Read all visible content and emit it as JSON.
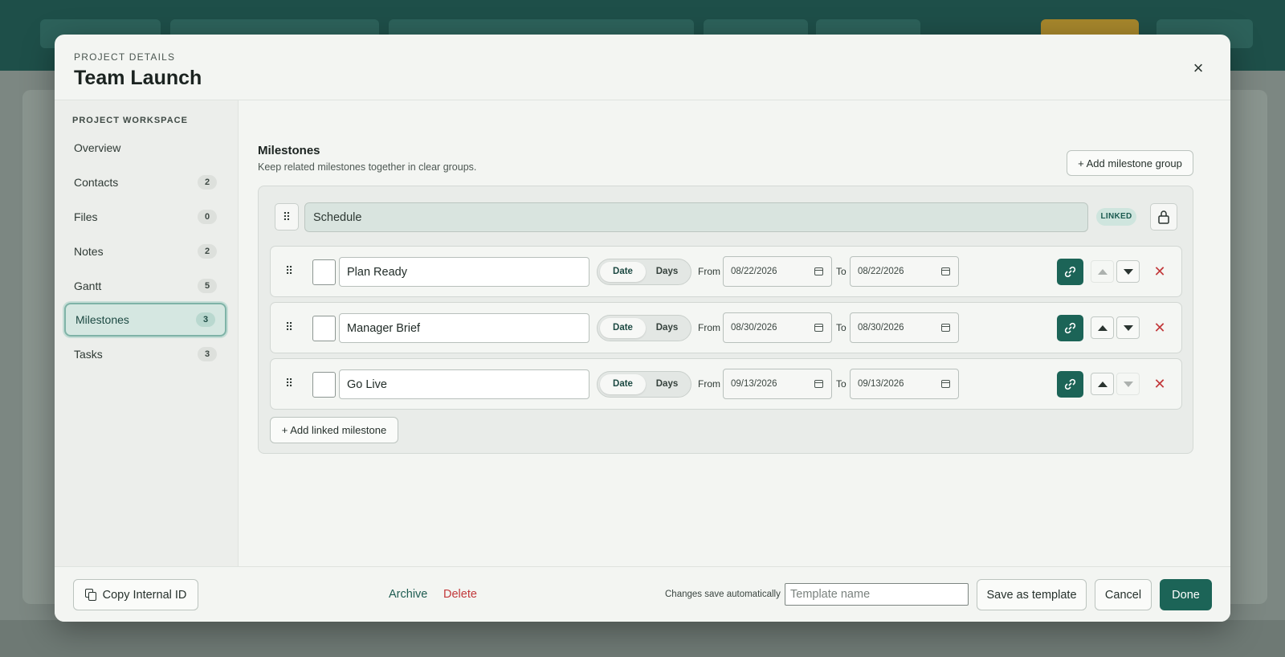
{
  "modal": {
    "eyebrow": "PROJECT DETAILS",
    "title": "Team Launch",
    "close_icon": "×"
  },
  "sidebar": {
    "heading": "PROJECT WORKSPACE",
    "items": [
      {
        "label": "Overview",
        "count": ""
      },
      {
        "label": "Contacts",
        "count": "2"
      },
      {
        "label": "Files",
        "count": "0"
      },
      {
        "label": "Notes",
        "count": "2"
      },
      {
        "label": "Gantt",
        "count": "5"
      },
      {
        "label": "Milestones",
        "count": "3",
        "active": true
      },
      {
        "label": "Tasks",
        "count": "3"
      }
    ]
  },
  "main": {
    "title": "Milestones",
    "subtitle": "Keep related milestones together in clear groups.",
    "add_group_label": "+ Add milestone group",
    "group": {
      "name": "Schedule",
      "badge": "LINKED",
      "milestones": [
        {
          "name": "Plan Ready",
          "mode_on": "Date",
          "mode_off": "Days",
          "from_label": "From",
          "from": "08/22/2026",
          "to_label": "To",
          "to": "08/22/2026"
        },
        {
          "name": "Manager Brief",
          "mode_on": "Date",
          "mode_off": "Days",
          "from_label": "From",
          "from": "08/30/2026",
          "to_label": "To",
          "to": "08/30/2026"
        },
        {
          "name": "Go Live",
          "mode_on": "Date",
          "mode_off": "Days",
          "from_label": "From",
          "from": "09/13/2026",
          "to_label": "To",
          "to": "09/13/2026"
        }
      ],
      "add_linked_label": "+ Add linked milestone"
    }
  },
  "footer": {
    "copy_id_label": "Copy Internal ID",
    "archive_label": "Archive",
    "delete_label": "Delete",
    "autosave_text": "Changes save automatically",
    "template_placeholder": "Template name",
    "save_template_label": "Save as template",
    "cancel_label": "Cancel",
    "done_label": "Done"
  },
  "colors": {
    "accent": "#1c6457",
    "danger": "#c2383a"
  }
}
